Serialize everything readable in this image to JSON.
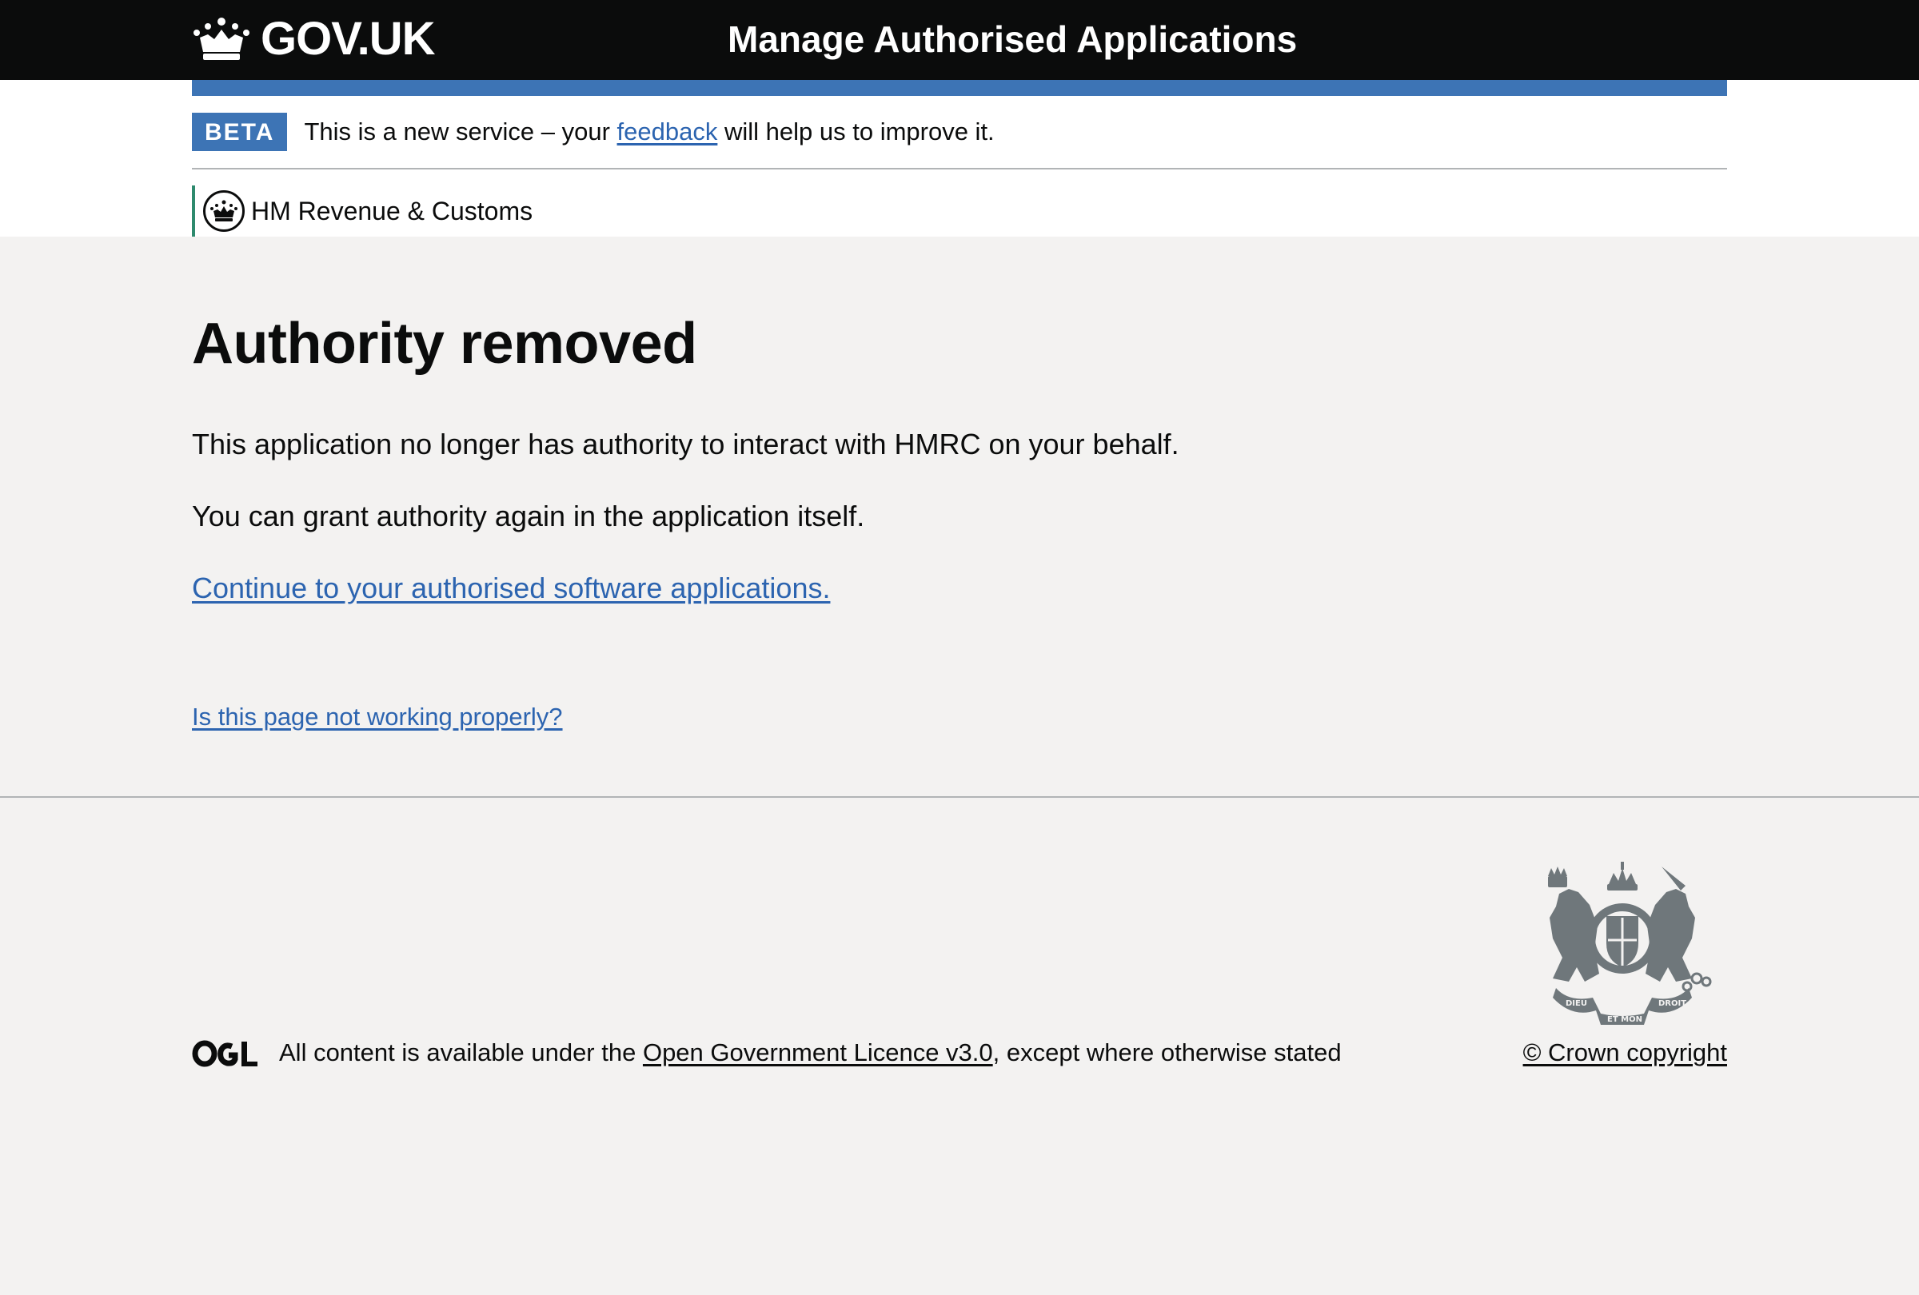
{
  "header": {
    "logo_text": "GOV.UK",
    "service_name": "Manage Authorised Applications"
  },
  "phase_banner": {
    "tag": "BETA",
    "text_before": "This is a new service – your ",
    "feedback_link": "feedback",
    "text_after": " will help us to improve it."
  },
  "organisation": {
    "name": "HM Revenue & Customs"
  },
  "main": {
    "heading": "Authority removed",
    "paragraph_1": "This application no longer has authority to interact with HMRC on your behalf.",
    "paragraph_2": "You can grant authority again in the application itself.",
    "continue_link": "Continue to your authorised software applications.",
    "report_link": "Is this page not working properly?"
  },
  "footer": {
    "licence_before": "All content is available under the ",
    "licence_link": "Open Government Licence v3.0",
    "licence_after": ", except where otherwise stated",
    "copyright": "© Crown copyright",
    "crest_motto_1": "DIEU",
    "crest_motto_2": "ET MON",
    "crest_motto_3": "DROIT"
  },
  "colors": {
    "header_bg": "#0b0c0c",
    "blue_bar": "#3d74b5",
    "link": "#2c64b0",
    "visited_link": "#3b2c90",
    "footer_bg": "#f3f2f1",
    "org_border": "#2e8a6e"
  },
  "icons": [
    "crown-icon",
    "hmrc-crest-icon",
    "royal-coat-of-arms-icon",
    "ogl-logo-icon"
  ]
}
